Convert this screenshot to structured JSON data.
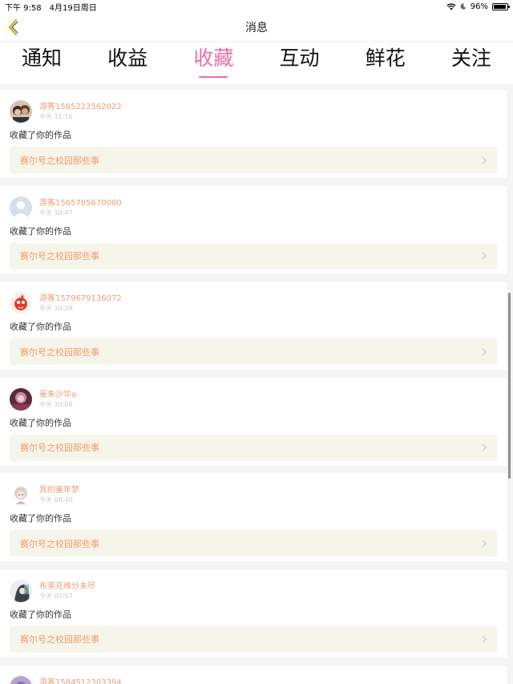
{
  "status_bar": {
    "time": "下午 9:58",
    "date": "4月19日周日",
    "battery": "96%"
  },
  "nav": {
    "title": "消息"
  },
  "tabs": [
    {
      "label": "通知",
      "active": false
    },
    {
      "label": "收益",
      "active": false
    },
    {
      "label": "收藏",
      "active": true
    },
    {
      "label": "互动",
      "active": false
    },
    {
      "label": "鲜花",
      "active": false
    },
    {
      "label": "关注",
      "active": false
    }
  ],
  "notifications": [
    {
      "username": "游客1585223562022",
      "time": "今天 11:16",
      "action": "收藏了你的作品",
      "work_title": "赛尔号之校园那些事"
    },
    {
      "username": "游客1565785670060",
      "time": "今天 10:47",
      "action": "收藏了你的作品",
      "work_title": "赛尔号之校园那些事"
    },
    {
      "username": "游客1579679136072",
      "time": "今天 10:29",
      "action": "收藏了你的作品",
      "work_title": "赛尔号之校园那些事"
    },
    {
      "username": "曼朱沙华a",
      "time": "今天 10:04",
      "action": "收藏了你的作品",
      "work_title": "赛尔号之校园那些事"
    },
    {
      "username": "我的童年梦",
      "time": "今天 08:40",
      "action": "收藏了你的作品",
      "work_title": "赛尔号之校园那些事"
    },
    {
      "username": "布莱克缘分未尽",
      "time": "今天 07:57",
      "action": "收藏了你的作品",
      "work_title": "赛尔号之校园那些事"
    }
  ],
  "partial": {
    "username": "游客1584512303394"
  },
  "colors": {
    "accent": "#e96fa9",
    "username": "#e8a07a",
    "work_title": "#f09a6a",
    "back_arrow": "#c8b42e"
  }
}
